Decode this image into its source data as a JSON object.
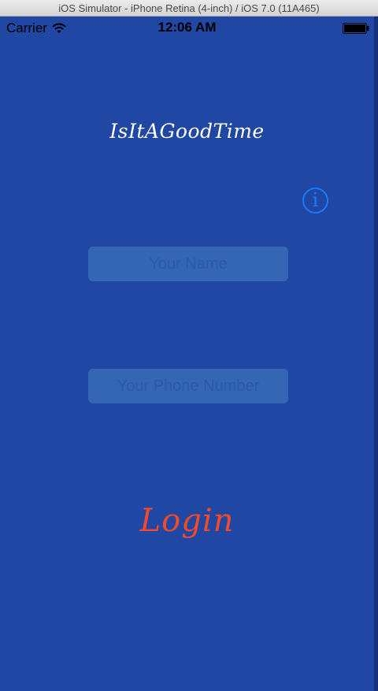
{
  "window": {
    "title": "iOS Simulator - iPhone Retina (4-inch) / iOS 7.0 (11A465)"
  },
  "status_bar": {
    "carrier": "Carrier",
    "time": "12:06 AM"
  },
  "app": {
    "title": "IsItAGoodTime",
    "info_glyph": "i",
    "name_placeholder": "Your Name",
    "phone_placeholder": "Your Phone Number",
    "login_label": "Login"
  },
  "colors": {
    "background": "#1f47a3",
    "field_background": "#3566b4",
    "placeholder_text": "#2a5ba8",
    "info_tint": "#1a7aff",
    "login_text": "#f24a2b",
    "title_text": "#ffffff"
  },
  "icons": {
    "wifi": "wifi-icon",
    "battery": "battery-icon",
    "info": "info-icon"
  }
}
